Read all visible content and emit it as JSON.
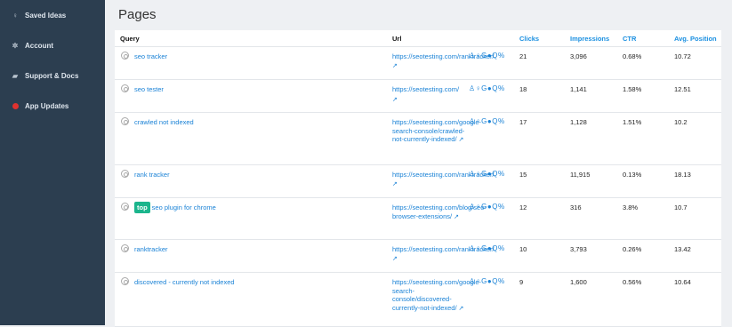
{
  "sidebar": {
    "items": [
      {
        "label": "Saved Ideas"
      },
      {
        "label": "Account"
      },
      {
        "label": "Support & Docs"
      },
      {
        "label": "App Updates"
      }
    ]
  },
  "page_title": "Pages",
  "table": {
    "headers": {
      "query": "Query",
      "url": "Url",
      "clicks": "Clicks",
      "impressions": "Impressions",
      "ctr": "CTR",
      "position": "Avg. Position"
    },
    "tool_icons": "♙♀G●Q%",
    "rows": [
      {
        "query": "seo tracker",
        "badge": "",
        "url_line1": "https://seotesting.com",
        "url_rest": "/ranktracker/",
        "clicks": "21",
        "impressions": "3,096",
        "ctr": "0.68%",
        "position": "10.72"
      },
      {
        "query": "seo tester",
        "badge": "",
        "url_line1": "https://seotesting.com",
        "url_rest": "/",
        "clicks": "18",
        "impressions": "1,141",
        "ctr": "1.58%",
        "position": "12.51"
      },
      {
        "query": "crawled not indexed",
        "badge": "",
        "url_line1": "https://seotesting.com",
        "url_rest": "/google-search-console/crawled-not-currently-indexed/",
        "clicks": "17",
        "impressions": "1,128",
        "ctr": "1.51%",
        "position": "10.2"
      },
      {
        "query": "rank tracker",
        "badge": "",
        "url_line1": "https://seotesting.com",
        "url_rest": "/ranktracker/",
        "clicks": "15",
        "impressions": "11,915",
        "ctr": "0.13%",
        "position": "18.13"
      },
      {
        "query": "seo plugin for chrome",
        "badge": "top",
        "url_line1": "https://seotesting.com",
        "url_rest": "/blog/seo-browser-extensions/",
        "clicks": "12",
        "impressions": "316",
        "ctr": "3.8%",
        "position": "10.7"
      },
      {
        "query": "ranktracker",
        "badge": "",
        "url_line1": "https://seotesting.com",
        "url_rest": "/ranktracker/",
        "clicks": "10",
        "impressions": "3,793",
        "ctr": "0.26%",
        "position": "13.42"
      },
      {
        "query": "discovered - currently not indexed",
        "badge": "",
        "url_line1": "https://seotesting.com",
        "url_rest": "/google-search-console/discovered-currently-not-indexed/",
        "clicks": "9",
        "impressions": "1,600",
        "ctr": "0.56%",
        "position": "10.64"
      }
    ]
  }
}
